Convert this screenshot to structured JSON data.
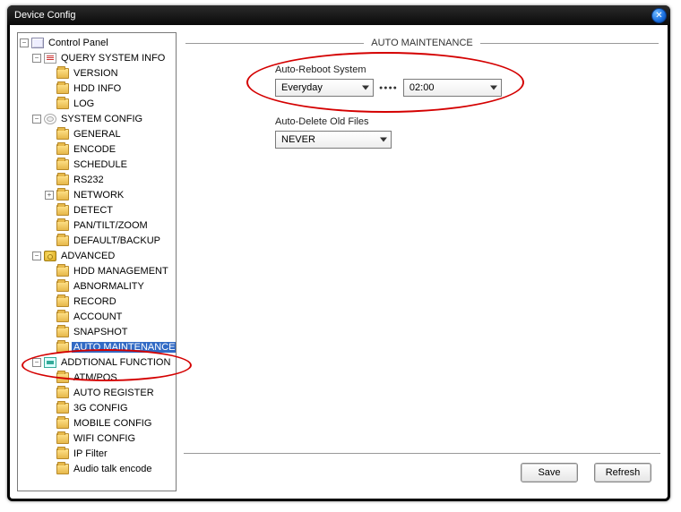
{
  "window": {
    "title": "Device Config"
  },
  "tree": {
    "root": "Control Panel",
    "groups": [
      {
        "label": "QUERY SYSTEM INFO",
        "items": [
          "VERSION",
          "HDD INFO",
          "LOG"
        ]
      },
      {
        "label": "SYSTEM CONFIG",
        "items": [
          "GENERAL",
          "ENCODE",
          "SCHEDULE",
          "RS232",
          "NETWORK",
          "DETECT",
          "PAN/TILT/ZOOM",
          "DEFAULT/BACKUP"
        ]
      },
      {
        "label": "ADVANCED",
        "items": [
          "HDD MANAGEMENT",
          "ABNORMALITY",
          "RECORD",
          "ACCOUNT",
          "SNAPSHOT",
          "AUTO MAINTENANCE"
        ]
      },
      {
        "label": "ADDTIONAL FUNCTION",
        "items": [
          "ATM/POS",
          "AUTO REGISTER",
          "3G CONFIG",
          "MOBILE CONFIG",
          "WIFI CONFIG",
          "IP Filter",
          "Audio talk encode"
        ]
      }
    ],
    "selected": "AUTO MAINTENANCE"
  },
  "panel": {
    "section_title": "AUTO MAINTENANCE",
    "reboot_label": "Auto-Reboot System",
    "reboot_frequency": "Everyday",
    "reboot_time": "02:00",
    "delete_label": "Auto-Delete Old Files",
    "delete_value": "NEVER"
  },
  "buttons": {
    "save": "Save",
    "refresh": "Refresh"
  }
}
